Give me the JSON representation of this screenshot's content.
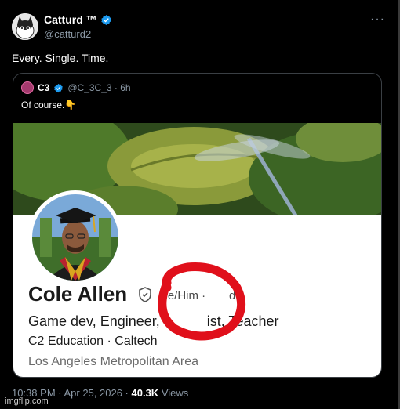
{
  "tweet": {
    "author_name": "Catturd ™",
    "author_handle": "@catturd2",
    "text": "Every. Single. Time.",
    "more_icon": "···",
    "timestamp": "10:38 PM · Apr 25, 2026 ·",
    "views_count": "40.3K",
    "views_label": "Views"
  },
  "quote": {
    "author_name": "C3",
    "handle_time": "@C_3C_3 · 6h",
    "text": "Of course.👇",
    "profile": {
      "name": "Cole Allen",
      "pronouns": "He/Him ·",
      "pronouns_tail": "d",
      "headline": "Game dev, Engineer,",
      "headline_end": "ist,  Teacher",
      "education": "C2 Education · Caltech",
      "location": "Los Angeles Metropolitan Area"
    }
  },
  "watermark": "imgflip.com",
  "colors": {
    "accent": "#1d9bf0",
    "highlight_circle": "#e0101b"
  }
}
